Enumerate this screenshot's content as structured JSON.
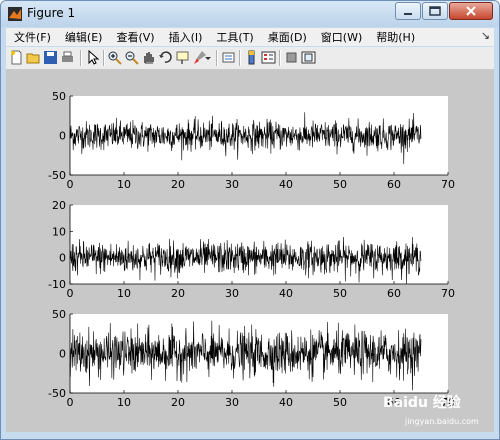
{
  "window": {
    "title": "Figure 1"
  },
  "menubar": {
    "items": [
      {
        "label": "文件(F)"
      },
      {
        "label": "编辑(E)"
      },
      {
        "label": "查看(V)"
      },
      {
        "label": "插入(I)"
      },
      {
        "label": "工具(T)"
      },
      {
        "label": "桌面(D)"
      },
      {
        "label": "窗口(W)"
      },
      {
        "label": "帮助(H)"
      }
    ],
    "overflow_arrow": "↘"
  },
  "toolbar": {
    "icons": [
      "new-figure-icon",
      "open-file-icon",
      "save-icon",
      "print-icon",
      "pointer-icon",
      "zoom-in-icon",
      "zoom-out-icon",
      "pan-icon",
      "rotate-3d-icon",
      "data-cursor-icon",
      "brush-icon",
      "link-plot-icon",
      "insert-colorbar-icon",
      "insert-legend-icon",
      "hide-plot-tools-icon",
      "show-plot-tools-icon"
    ]
  },
  "watermark": {
    "text": "Baidu 经验",
    "sub": "jingyan.baidu.com"
  },
  "chart_data": [
    {
      "type": "line",
      "series": [
        {
          "values": "dense noise signal, ~±15 typical, peaks ~±30"
        }
      ],
      "x_range": [
        0,
        65
      ],
      "xlim": [
        0,
        70
      ],
      "ylim": [
        -50,
        50
      ],
      "xticks": [
        0,
        10,
        20,
        30,
        40,
        50,
        60,
        70
      ],
      "yticks": [
        -50,
        0,
        50
      ],
      "amplitude": 9,
      "grid": false
    },
    {
      "type": "line",
      "series": [
        {
          "values": "dense noise signal, ~±5 typical, peaks ~±10"
        }
      ],
      "x_range": [
        0,
        65
      ],
      "xlim": [
        0,
        70
      ],
      "ylim": [
        -10,
        20
      ],
      "xticks": [
        0,
        10,
        20,
        30,
        40,
        50,
        60,
        70
      ],
      "yticks": [
        -10,
        0,
        10,
        20
      ],
      "amplitude": 3,
      "grid": false
    },
    {
      "type": "line",
      "series": [
        {
          "values": "dense noise signal, ~±20 typical, peaks ~±40"
        }
      ],
      "x_range": [
        0,
        65
      ],
      "xlim": [
        0,
        70
      ],
      "ylim": [
        -50,
        50
      ],
      "xticks": [
        0,
        10,
        20,
        30,
        40,
        50,
        60,
        70
      ],
      "yticks": [
        -50,
        0,
        50
      ],
      "amplitude": 14,
      "grid": false
    }
  ],
  "colors": {
    "window_frame": "#c7dbef",
    "figure_bg": "#c8c8c8",
    "axes_bg": "#ffffff",
    "signal": "#000000"
  }
}
